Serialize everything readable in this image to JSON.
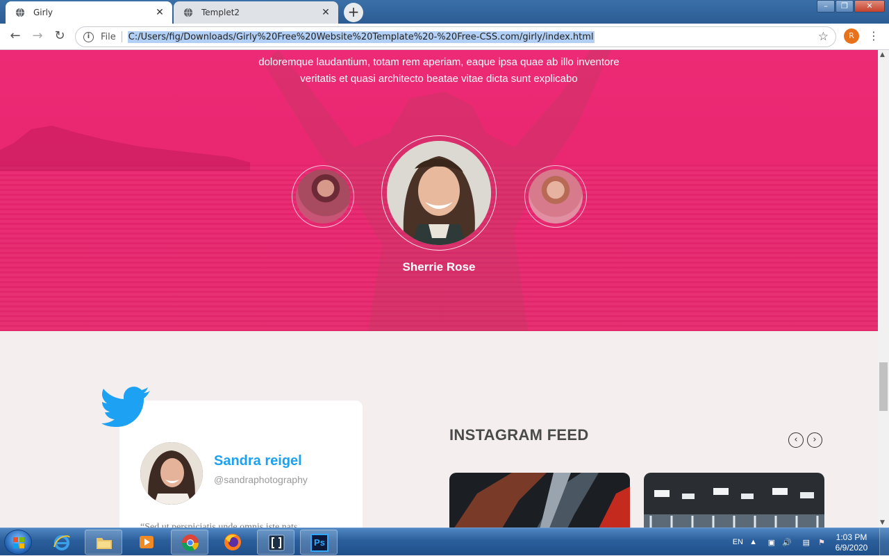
{
  "browser": {
    "tabs": [
      {
        "title": "Girly",
        "active": true
      },
      {
        "title": "Templet2",
        "active": false
      }
    ],
    "new_tab": "+",
    "omnibox": {
      "scheme_label": "File",
      "url": "C:/Users/fig/Downloads/Girly%20Free%20Website%20Template%20-%20Free-CSS.com/girly/index.html"
    },
    "profile_initial": "R",
    "window_buttons": [
      "–",
      "❐",
      "✕"
    ]
  },
  "page": {
    "hero": {
      "text_line1": "doloremque laudantium, totam rem aperiam, eaque ipsa quae ab illo inventore",
      "text_line2": "veritatis et quasi architecto beatae vitae dicta sunt explicabo",
      "active_testimonial_name": "Sherrie Rose",
      "accent_color": "#e8266f"
    },
    "twitter_card": {
      "name": "Sandra reigel",
      "handle": "@sandraphotography",
      "quote_start": "“Sed ut perspiciatis unde omnis iste nats",
      "brand_color": "#1da1f2"
    },
    "instagram": {
      "title": "INSTAGRAM FEED",
      "prev": "‹",
      "next": "›"
    }
  },
  "taskbar": {
    "pinned": [
      "internet-explorer",
      "file-explorer",
      "media-player",
      "chrome",
      "firefox",
      "app-brackets",
      "photoshop"
    ],
    "photoshop_label": "Ps",
    "language": "EN",
    "time": "1:03 PM",
    "date": "6/9/2020"
  }
}
